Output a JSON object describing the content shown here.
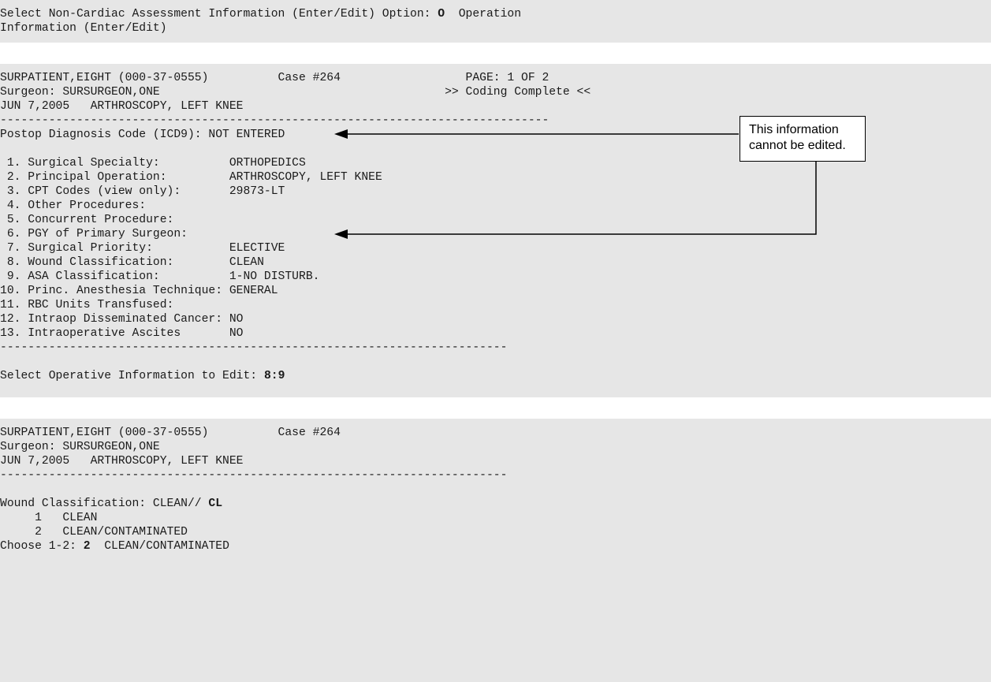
{
  "block1": {
    "line1_prefix": "Select Non-Cardiac Assessment Information (Enter/Edit) Option: ",
    "line1_input": "O",
    "line1_suffix": "  Operation",
    "line2": "Information (Enter/Edit)"
  },
  "block2": {
    "header_line1": "SURPATIENT,EIGHT (000-37-0555)          Case #264                  PAGE: 1 OF 2",
    "header_line2": "Surgeon: SURSURGEON,ONE                                         >> Coding Complete <<",
    "header_line3": "JUN 7,2005   ARTHROSCOPY, LEFT KNEE",
    "divider_top": "-------------------------------------------------------------------------------",
    "postop_line": "Postop Diagnosis Code (ICD9): NOT ENTERED",
    "items": [
      " 1. Surgical Specialty:          ORTHOPEDICS",
      " 2. Principal Operation:         ARTHROSCOPY, LEFT KNEE",
      " 3. CPT Codes (view only):       29873-LT",
      " 4. Other Procedures:",
      " 5. Concurrent Procedure:",
      " 6. PGY of Primary Surgeon:",
      " 7. Surgical Priority:           ELECTIVE",
      " 8. Wound Classification:        CLEAN",
      " 9. ASA Classification:          1-NO DISTURB.",
      "10. Princ. Anesthesia Technique: GENERAL",
      "11. RBC Units Transfused:",
      "12. Intraop Disseminated Cancer: NO",
      "13. Intraoperative Ascites       NO"
    ],
    "divider_bottom": "-------------------------------------------------------------------------",
    "prompt_prefix": "Select Operative Information to Edit: ",
    "prompt_input": "8:9"
  },
  "callout": {
    "line1": "This information",
    "line2": "cannot be edited."
  },
  "block3": {
    "header_line1": "SURPATIENT,EIGHT (000-37-0555)          Case #264",
    "header_line2": "Surgeon: SURSURGEON,ONE",
    "header_line3": "JUN 7,2005   ARTHROSCOPY, LEFT KNEE",
    "divider": "-------------------------------------------------------------------------",
    "wound_prefix": "Wound Classification: CLEAN// ",
    "wound_input": "CL",
    "option1": "     1   CLEAN",
    "option2": "     2   CLEAN/CONTAMINATED",
    "choose_prefix": "Choose 1-2: ",
    "choose_input": "2",
    "choose_suffix": "  CLEAN/CONTAMINATED"
  }
}
